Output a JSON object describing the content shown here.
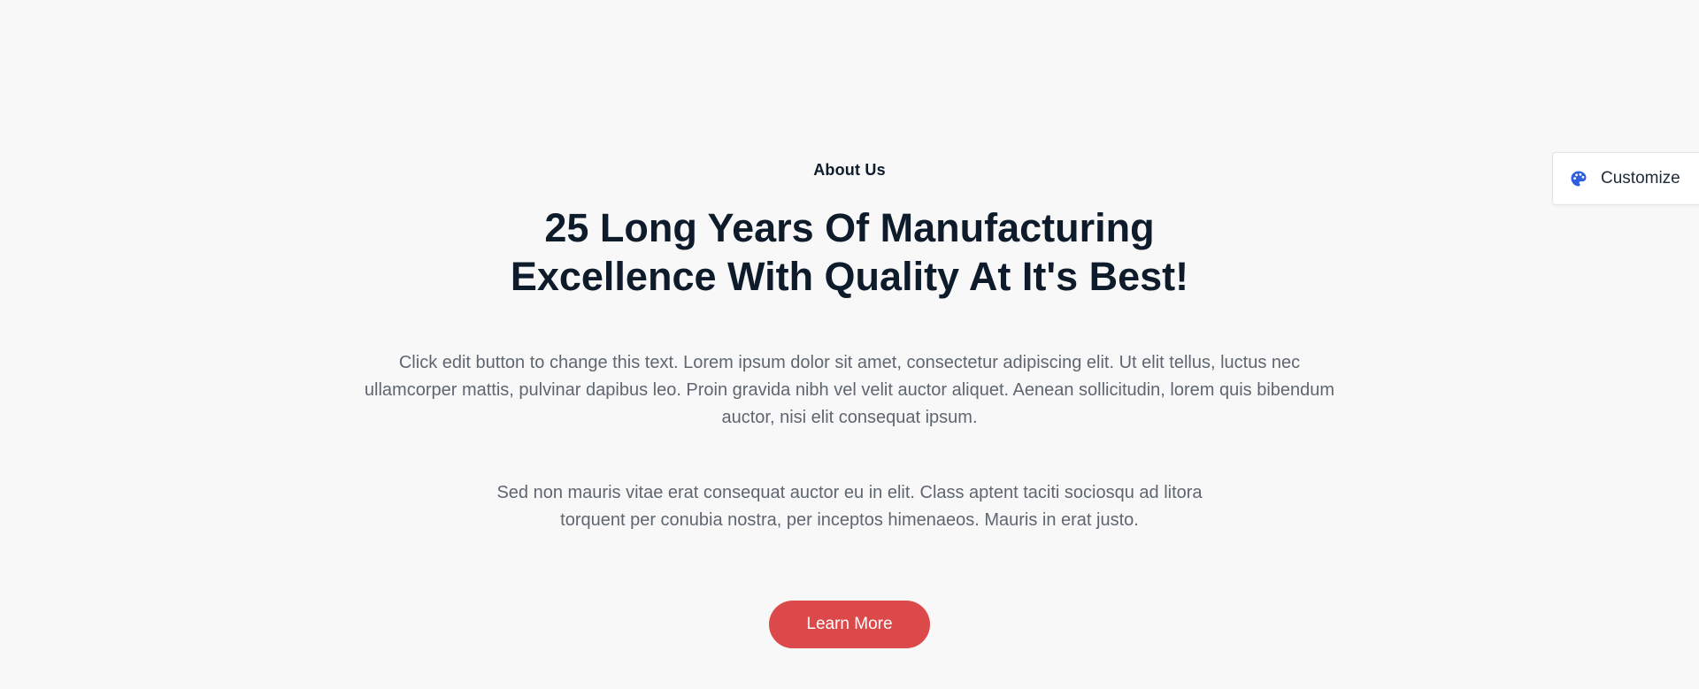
{
  "about": {
    "eyebrow": "About Us",
    "headline_line1": "25 Long Years Of Manufacturing",
    "headline_line2": "Excellence With Quality At It's Best!",
    "paragraph_1": "Click edit button to change this text. Lorem ipsum dolor sit amet, consectetur adipiscing elit. Ut elit tellus, luctus nec ullamcorper mattis, pulvinar dapibus leo. Proin gravida nibh vel velit auctor aliquet. Aenean sollicitudin, lorem quis bibendum auctor, nisi elit consequat ipsum.",
    "paragraph_2": "Sed non mauris vitae erat consequat auctor eu in elit. Class aptent taciti sociosqu ad litora torquent per conubia nostra, per inceptos himenaeos. Mauris in erat justo.",
    "cta_label": "Learn More"
  },
  "customize": {
    "label": "Customize",
    "icon": "palette-icon"
  },
  "colors": {
    "background": "#f8f8f8",
    "heading": "#0d1b2a",
    "body_text": "#5e6670",
    "cta_background": "#dc494a",
    "icon_accent": "#2f5fe0"
  }
}
